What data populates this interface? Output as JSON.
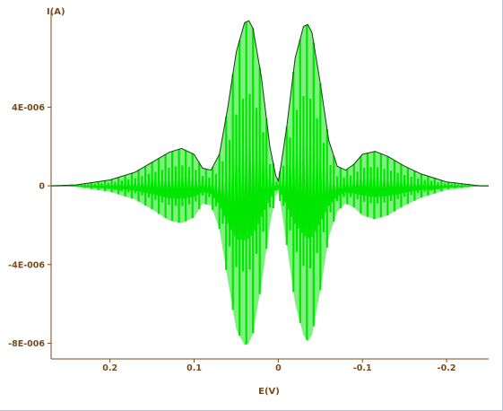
{
  "chart_data": {
    "type": "line",
    "title": "",
    "xlabel": "E(V)",
    "ylabel": "I(A)",
    "x_reversed": true,
    "xlim": [
      0.27,
      -0.25
    ],
    "ylim": [
      -8.8e-06,
      8.9e-06
    ],
    "x_ticks": [
      {
        "value": 0.2,
        "label": "0.2"
      },
      {
        "value": 0.1,
        "label": "0.1"
      },
      {
        "value": 0.0,
        "label": "0"
      },
      {
        "value": -0.1,
        "label": "-0.1"
      },
      {
        "value": -0.2,
        "label": "-0.2"
      }
    ],
    "y_ticks": [
      {
        "value": 4e-06,
        "label": "4E-006"
      },
      {
        "value": 0,
        "label": "0"
      },
      {
        "value": -4e-06,
        "label": "-4E-006"
      },
      {
        "value": -8e-06,
        "label": "-8E-006"
      }
    ],
    "grid": false,
    "colors": {
      "fill_dark": "#00e600",
      "fill_light": "#7ff07f",
      "envelope": "#1a3a1a",
      "axis": "#7a4a1c"
    },
    "series": [
      {
        "style": "oscillating-fill",
        "upper_envelope": {
          "x": [
            0.27,
            0.24,
            0.2,
            0.17,
            0.15,
            0.13,
            0.115,
            0.1,
            0.09,
            0.08,
            0.07,
            0.06,
            0.05,
            0.04,
            0.035,
            0.03,
            0.02,
            0.01,
            0.003,
            0.0,
            -0.003,
            -0.01,
            -0.02,
            -0.03,
            -0.035,
            -0.04,
            -0.05,
            -0.06,
            -0.07,
            -0.08,
            -0.09,
            -0.1,
            -0.115,
            -0.13,
            -0.15,
            -0.17,
            -0.2,
            -0.24,
            -0.25
          ],
          "y": [
            0.0,
            5e-08,
            3e-07,
            7e-07,
            1.2e-06,
            1.7e-06,
            1.9e-06,
            1.6e-06,
            9e-07,
            8e-07,
            1.6e-06,
            4e-06,
            6.8e-06,
            8.3e-06,
            8.4e-06,
            8e-06,
            5.5e-06,
            2e-06,
            5e-07,
            2.5e-07,
            1e-06,
            3e-06,
            6.5e-06,
            8.1e-06,
            8.2e-06,
            7.8e-06,
            5.2e-06,
            2.3e-06,
            1e-06,
            8e-07,
            1.1e-06,
            1.6e-06,
            1.75e-06,
            1.5e-06,
            1e-06,
            6e-07,
            2e-07,
            0.0,
            0.0
          ]
        },
        "lower_envelope": {
          "x": [
            0.27,
            0.24,
            0.2,
            0.17,
            0.15,
            0.13,
            0.115,
            0.1,
            0.09,
            0.08,
            0.07,
            0.06,
            0.05,
            0.04,
            0.035,
            0.03,
            0.02,
            0.01,
            0.003,
            0.0,
            -0.003,
            -0.01,
            -0.02,
            -0.03,
            -0.035,
            -0.04,
            -0.05,
            -0.06,
            -0.07,
            -0.08,
            -0.09,
            -0.1,
            -0.115,
            -0.13,
            -0.15,
            -0.17,
            -0.2,
            -0.24,
            -0.25
          ],
          "y": [
            0.0,
            -5e-08,
            -3e-07,
            -7e-07,
            -1.2e-06,
            -1.75e-06,
            -1.9e-06,
            -1.6e-06,
            -9e-07,
            -1e-06,
            -2.2e-06,
            -4.8e-06,
            -7.3e-06,
            -8.1e-06,
            -8e-06,
            -7.5e-06,
            -5e-06,
            -2e-06,
            -5e-07,
            -3e-07,
            -1e-06,
            -3e-06,
            -6e-06,
            -7.6e-06,
            -7.9e-06,
            -7.6e-06,
            -5.3e-06,
            -2.6e-06,
            -1.3e-06,
            -9e-07,
            -1.1e-06,
            -1.5e-06,
            -1.7e-06,
            -1.5e-06,
            -1e-06,
            -6e-07,
            -2e-07,
            -0.0,
            -0.0
          ]
        }
      }
    ]
  }
}
